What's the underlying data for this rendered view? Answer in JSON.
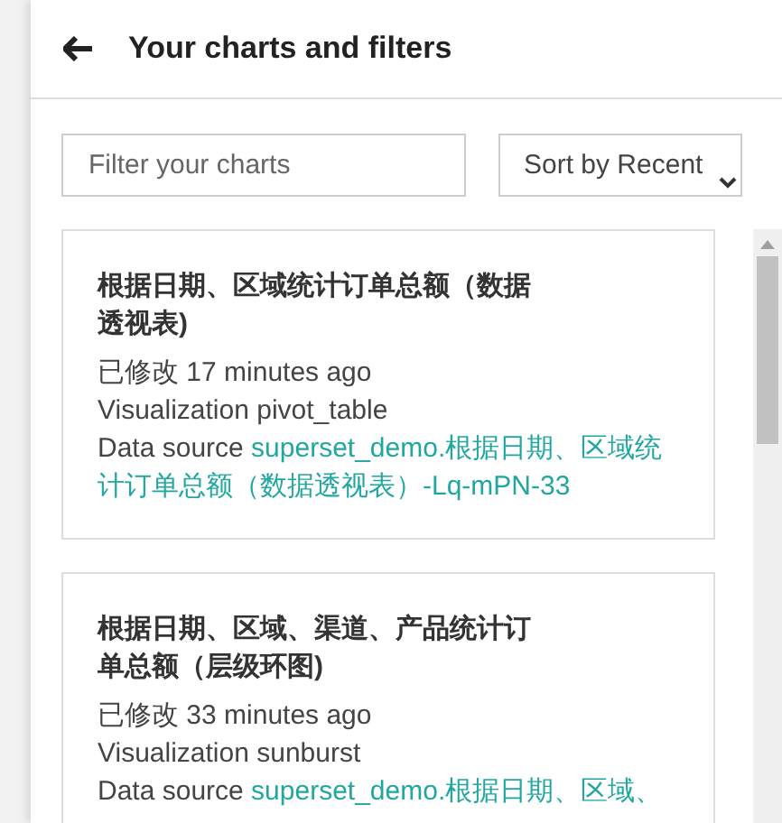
{
  "header": {
    "title": "Your charts and filters"
  },
  "filter": {
    "placeholder": "Filter your charts"
  },
  "sort": {
    "value": "Sort by Recent"
  },
  "charts": [
    {
      "title": "根据日期、区域统计订单总额（数据透视表)",
      "modified_label": "已修改",
      "modified": "17 minutes ago",
      "visualization_label": "Visualization",
      "visualization": "pivot_table",
      "source_label": "Data source",
      "source": "superset_demo.根据日期、区域统计订单总额（数据透视表）-Lq-mPN-33"
    },
    {
      "title": "根据日期、区域、渠道、产品统计订单总额（层级环图)",
      "modified_label": "已修改",
      "modified": "33 minutes ago",
      "visualization_label": "Visualization",
      "visualization": "sunburst",
      "source_label": "Data source",
      "source": "superset_demo.根据日期、区域、"
    }
  ]
}
